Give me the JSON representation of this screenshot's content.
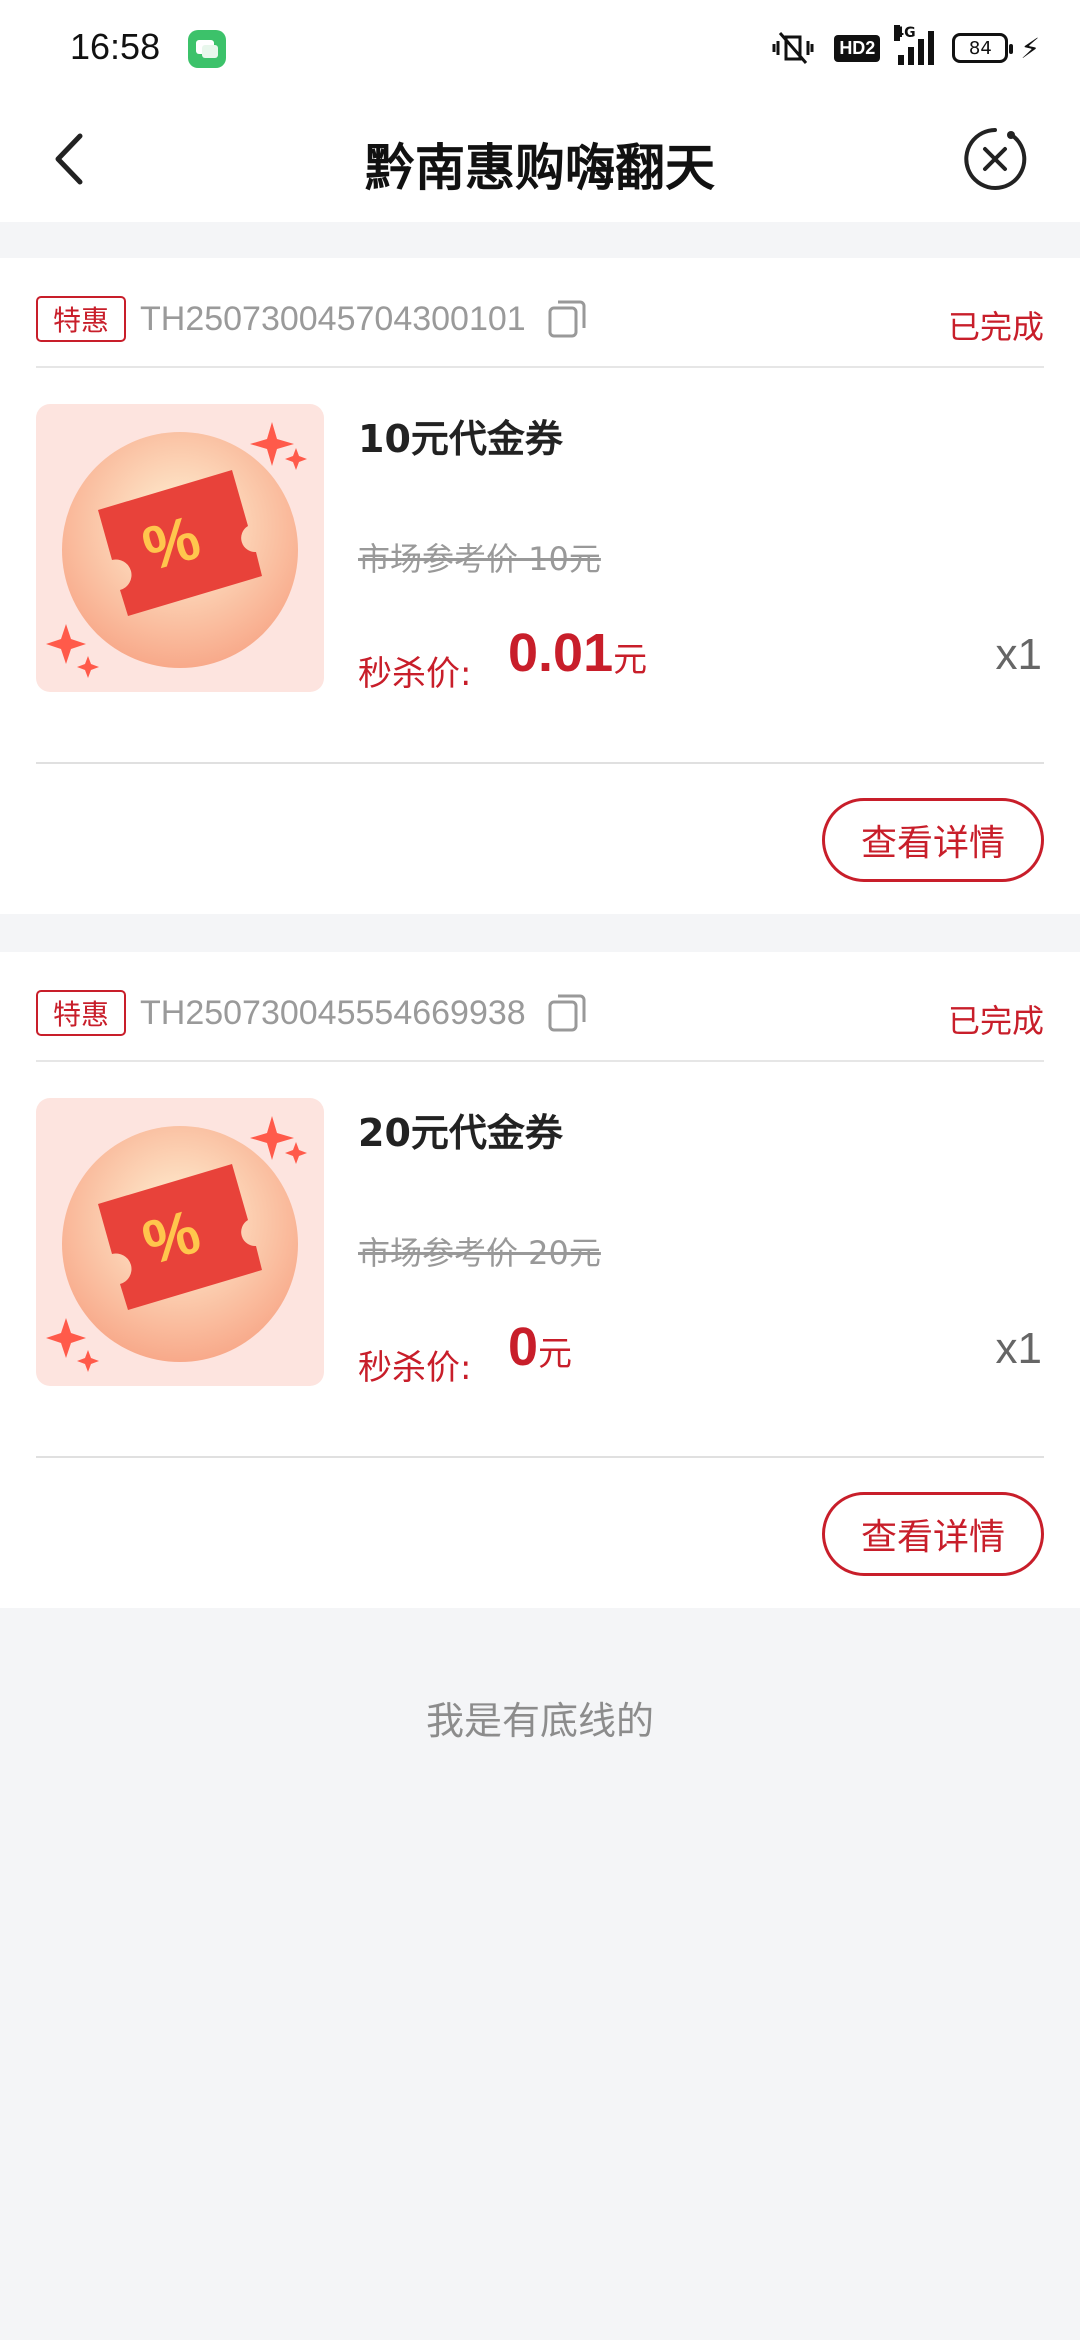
{
  "status_bar": {
    "time": "16:58",
    "network": "4G",
    "hd_label": "HD2",
    "battery": "84",
    "icons": [
      "chat-app-icon",
      "vibrate-mute-icon",
      "signal-icon",
      "battery-icon",
      "charging-icon"
    ]
  },
  "nav": {
    "title": "黔南惠购嗨翻天",
    "back_icon": "chevron-left-icon",
    "close_icon": "close-circle-icon"
  },
  "orders": [
    {
      "tag": "特惠",
      "order_no": "TH250730045704300101",
      "status": "已完成",
      "title": "10元代金券",
      "ref_price": "市场参考价 10元",
      "price_label": "秒杀价:",
      "price_value": "0.01",
      "price_unit": "元",
      "quantity": "x1",
      "detail_button": "查看详情"
    },
    {
      "tag": "特惠",
      "order_no": "TH250730045554669938",
      "status": "已完成",
      "title": "20元代金券",
      "ref_price": "市场参考价 20元",
      "price_label": "秒杀价:",
      "price_value": "0",
      "price_unit": "元",
      "quantity": "x1",
      "detail_button": "查看详情"
    }
  ],
  "footer": {
    "end_text": "我是有底线的"
  },
  "colors": {
    "accent": "#c81e2a",
    "background": "#f4f5f7",
    "thumb_bg": "#fde4df"
  }
}
